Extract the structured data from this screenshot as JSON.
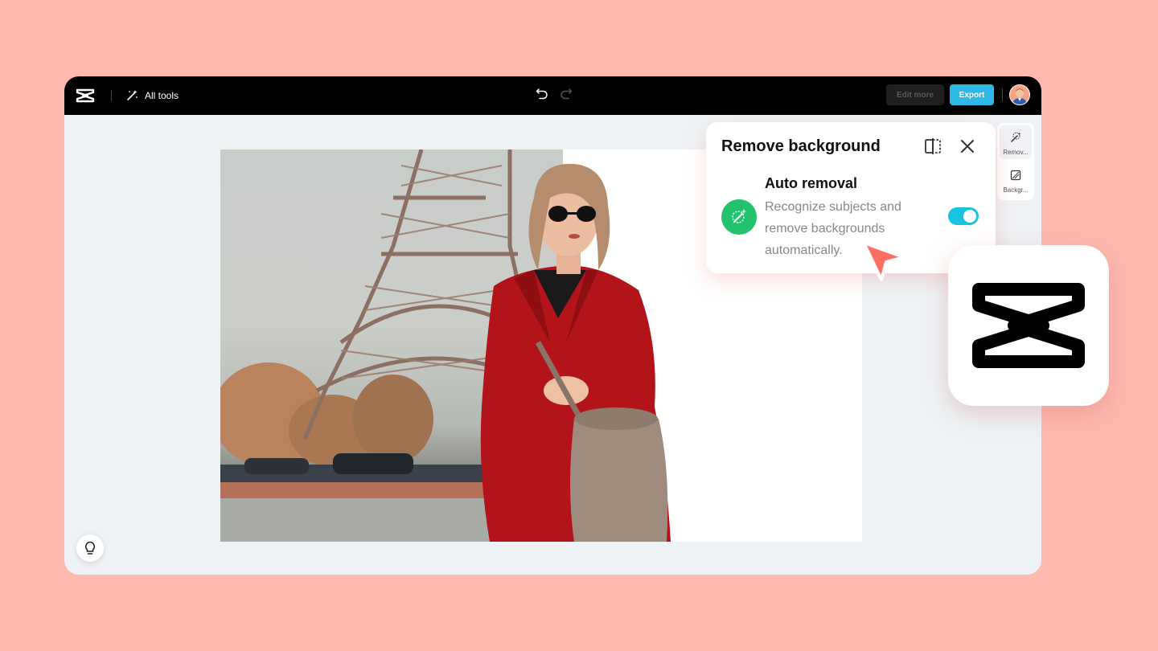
{
  "header": {
    "all_tools_label": "All tools",
    "edit_more_label": "Edit more",
    "export_label": "Export"
  },
  "side_tools": [
    {
      "label": "Remov...",
      "icon": "remove-bg-icon"
    },
    {
      "label": "Backgr...",
      "icon": "background-icon"
    }
  ],
  "remove_panel": {
    "title": "Remove background",
    "auto_removal": {
      "title": "Auto removal",
      "description": "Recognize subjects and remove backgrounds automatically.",
      "enabled": true
    }
  },
  "colors": {
    "page_background": "#ffb9af",
    "export_button": "#2eb8e6",
    "toggle_on": "#18c2e3",
    "feature_icon": "#22c36c",
    "cursor": "#ff6f61"
  }
}
